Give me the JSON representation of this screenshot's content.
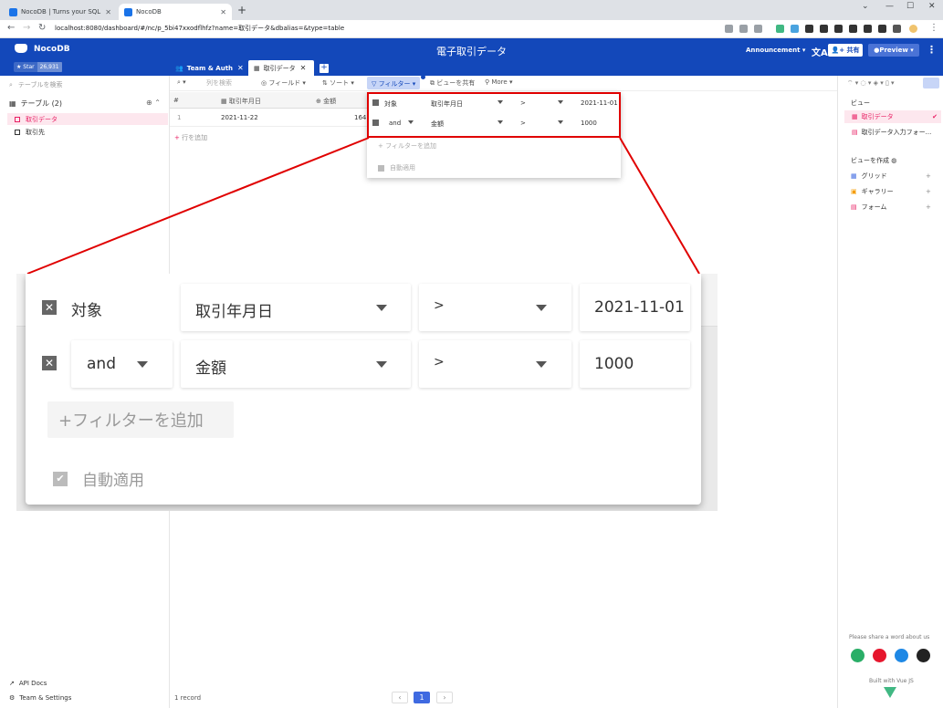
{
  "browser": {
    "tabs": [
      {
        "title": "NocoDB | Turns your SQL datab...",
        "active": false
      },
      {
        "title": "NocoDB",
        "active": true
      }
    ],
    "url": "localhost:8080/dashboard/#/nc/p_5bi47xxodflhfz?name=取引データ&dbalias=&type=table"
  },
  "header": {
    "logo": "NocoDB",
    "star_label": "Star",
    "star_count": "26,931",
    "title": "電子取引データ",
    "announcement": "Announcement ▾",
    "share_label": "共有",
    "preview_label": "Preview ▾"
  },
  "tabs": [
    {
      "label": "Team & Auth"
    },
    {
      "label": "取引データ"
    }
  ],
  "left_sidebar": {
    "search_placeholder": "テーブルを検索",
    "section_label": "テーブル (2)",
    "tables": [
      {
        "label": "取引データ",
        "selected": true
      },
      {
        "label": "取引先",
        "selected": false
      }
    ],
    "api_docs": "API Docs",
    "team_settings": "Team & Settings"
  },
  "toolbar": {
    "search_placeholder": "列を検索",
    "fields": "フィールド ▾",
    "sort": "ソート ▾",
    "filter": "フィルター ▾",
    "share_view": "ビューを共有",
    "more": "More ▾"
  },
  "grid": {
    "headers": [
      "#",
      "取引年月日",
      "金額"
    ],
    "rows": [
      {
        "num": "1",
        "date": "2021-11-22",
        "amount": "164"
      }
    ],
    "add_row": "行を追加",
    "record_count": "1 record",
    "page": "1"
  },
  "filter": {
    "rows": [
      {
        "conj": "対象",
        "field": "取引年月日",
        "op": ">",
        "value": "2021-11-01"
      },
      {
        "conj": "and",
        "field": "金額",
        "op": ">",
        "value": "1000"
      }
    ],
    "add_filter": "フィルターを追加",
    "add_filter_zoom": "+フィルターを追加",
    "auto_apply": "自動適用"
  },
  "right_sidebar": {
    "views_label": "ビュー",
    "views": [
      {
        "label": "取引データ",
        "selected": true
      },
      {
        "label": "取引データ入力フォー...",
        "selected": false
      }
    ],
    "create_label": "ビューを作成",
    "create_items": [
      "グリッド",
      "ギャラリー",
      "フォーム"
    ],
    "feedback": "Please share a word about us",
    "built_with": "Built with Vue JS"
  },
  "colors": {
    "brand": "#1348ba",
    "accent_pink": "#e91e63",
    "callout_red": "#e00000"
  }
}
